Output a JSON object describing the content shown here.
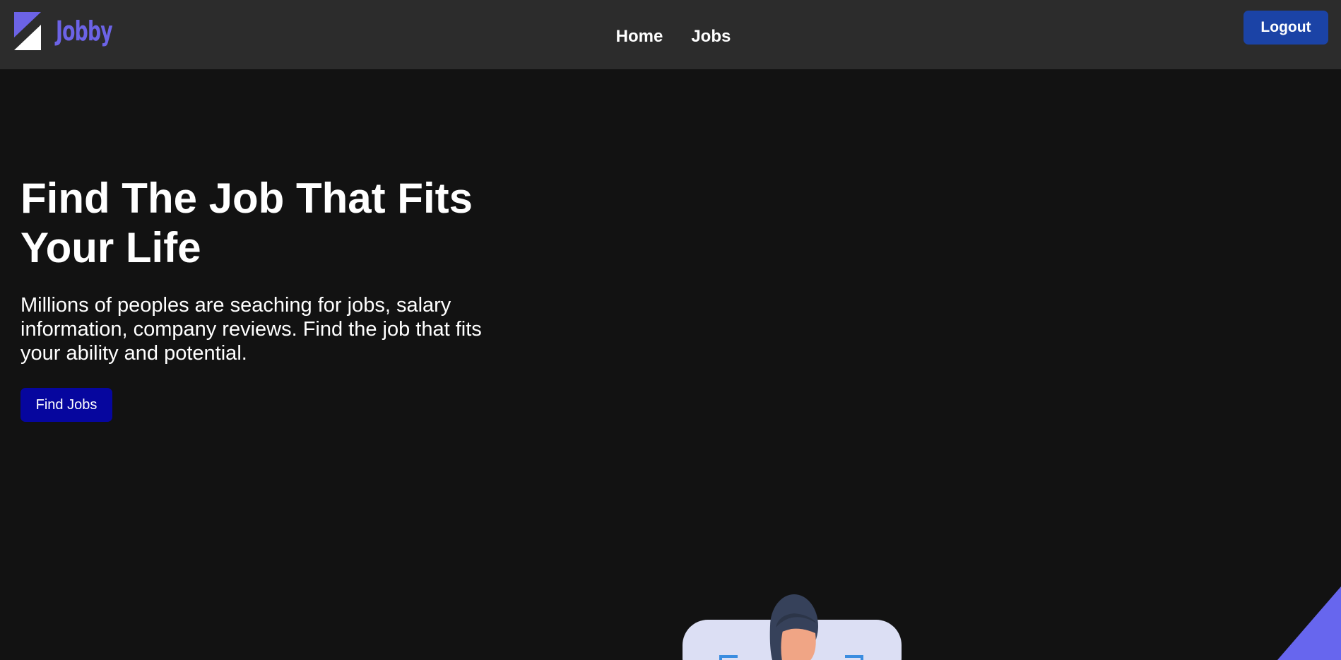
{
  "nav": {
    "brand": "Jobby",
    "links": [
      {
        "label": "Home"
      },
      {
        "label": "Jobs"
      }
    ],
    "logout_label": "Logout"
  },
  "hero": {
    "title": "Find The Job That Fits Your Life",
    "description": "Millions of peoples are seaching for jobs, salary information, company reviews. Find the job that fits your ability and potential.",
    "cta_label": "Find Jobs"
  },
  "colors": {
    "page_bg": "#121212",
    "navbar_bg": "#2c2c2c",
    "brand": "#6c63e6",
    "logout_bg": "#1b43a6",
    "cta_bg": "#06069e"
  },
  "icons": {
    "logo": "jobby-logo-icon",
    "illustration": "person-at-screen-illustration",
    "decoration": "purple-corner-shape"
  }
}
